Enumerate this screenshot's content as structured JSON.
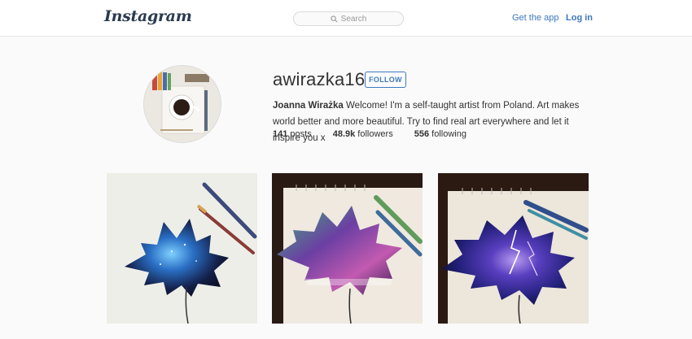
{
  "header": {
    "logo": "Instagram",
    "search_placeholder": "Search",
    "get_app": "Get the app",
    "login": "Log in"
  },
  "profile": {
    "username": "awirazka16",
    "follow_label": "FOLLOW",
    "full_name": "Joanna Wirażka",
    "bio": " Welcome! I'm a self-taught artist from Poland. Art makes world better and more beautiful. Try to find real art everywhere and let it inspire you x",
    "stats": {
      "posts_count": "141",
      "posts_label": " posts",
      "followers_count": "48.9k",
      "followers_label": " followers",
      "following_count": "556",
      "following_label": " following"
    }
  },
  "posts": [
    {
      "icon": "maple-leaf-galaxy-painting"
    },
    {
      "icon": "maple-leaf-aurora-painting"
    },
    {
      "icon": "maple-leaf-lightning-painting"
    }
  ],
  "colors": {
    "link_blue": "#3b77c0",
    "background": "#fafafa"
  }
}
